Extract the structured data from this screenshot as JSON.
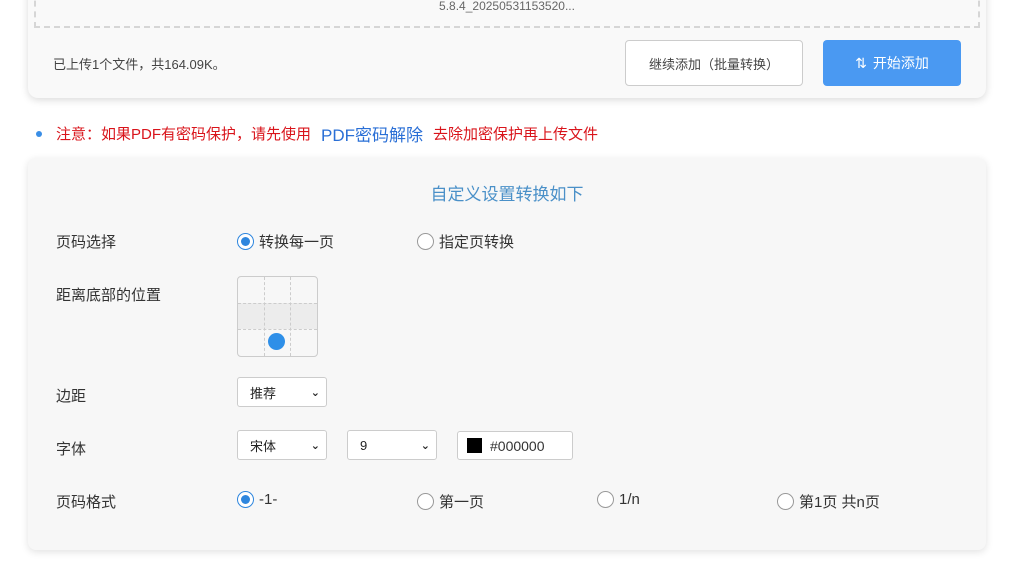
{
  "upload": {
    "file_name": "5.8.4_20250531153520...",
    "summary": "已上传1个文件，共164.09K。",
    "continue_button": "继续添加（批量转换）",
    "start_button": "开始添加"
  },
  "notice": {
    "prefix": "注意：如果PDF有密码保护，请先使用",
    "link": "PDF密码解除",
    "suffix": "去除加密保护再上传文件"
  },
  "settings": {
    "title": "自定义设置转换如下",
    "page_select": {
      "label": "页码选择",
      "options": [
        "转换每一页",
        "指定页转换"
      ],
      "selected": 0
    },
    "position": {
      "label": "距离底部的位置",
      "selected_cell": "bottom-center"
    },
    "margin": {
      "label": "边距",
      "value": "推荐"
    },
    "font": {
      "label": "字体",
      "family": "宋体",
      "size": "9",
      "color": "#000000"
    },
    "format": {
      "label": "页码格式",
      "options": [
        "-1-",
        "第一页",
        "1/n",
        "第1页 共n页"
      ],
      "selected": 0
    }
  },
  "colors": {
    "accent": "#4a99f2",
    "notice": "#d9141b",
    "link": "#2a6fd6"
  }
}
